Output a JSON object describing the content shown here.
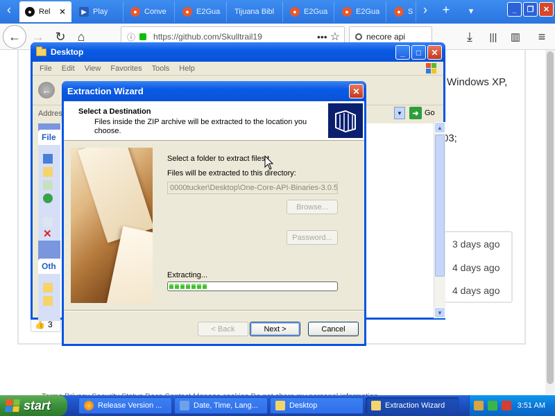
{
  "browser": {
    "tabs": [
      {
        "label": "Rel",
        "icon": "github-icon",
        "active": true
      },
      {
        "label": "Play",
        "icon": "play-icon",
        "active": false
      },
      {
        "label": "Conve",
        "icon": "duckduckgo-icon",
        "active": false
      },
      {
        "label": "E2Gua",
        "icon": "duckduckgo-icon",
        "active": false
      },
      {
        "label": "Tijuana Bibl",
        "icon": "none",
        "active": false
      },
      {
        "label": "E2Gua",
        "icon": "duckduckgo-icon",
        "active": false
      },
      {
        "label": "E2Gua",
        "icon": "duckduckgo-icon",
        "active": false
      },
      {
        "label": "S",
        "icon": "duckduckgo-icon",
        "active": false
      }
    ],
    "url": "https://github.com/Skulltrail19",
    "search_value": "necore api"
  },
  "page": {
    "text_lines": [
      "Windows XP,",
      "03;"
    ],
    "commit_times": [
      "3 days ago",
      "4 days ago",
      "4 days ago"
    ],
    "reaction_count": "3",
    "footer": "Terms  Privacy  Security  Status  Docs  Contact  Manage cookies  Do not share my personal information"
  },
  "explorer": {
    "title": "Desktop",
    "menu": [
      "File",
      "Edit",
      "View",
      "Favorites",
      "Tools",
      "Help"
    ],
    "address_label": "Addres",
    "go_label": "Go",
    "panel_headers": [
      "File",
      "Oth"
    ]
  },
  "wizard": {
    "title": "Extraction Wizard",
    "heading": "Select a Destination",
    "subheading": "Files inside the ZIP archive will be extracted to the location you choose.",
    "select_folder_label": "Select a folder to extract files t",
    "extract_dir_label": "Files will be extracted to this directory:",
    "path_value": "0000tucker\\Desktop\\One-Core-API-Binaries-3.0.5",
    "browse_label": "Browse...",
    "password_label": "Password...",
    "status_label": "Extracting...",
    "progress": 0.22,
    "back_label": "< Back",
    "next_label": "Next >",
    "cancel_label": "Cancel"
  },
  "taskbar": {
    "start_label": "start",
    "items": [
      {
        "label": "Release Version ...",
        "icon": "firefox-icon",
        "active": false
      },
      {
        "label": "Date, Time, Lang...",
        "icon": "control-panel-icon",
        "active": false
      },
      {
        "label": "Desktop",
        "icon": "folder-icon",
        "active": false
      },
      {
        "label": "Extraction Wizard",
        "icon": "folder-icon",
        "active": true
      }
    ],
    "clock": "3:51 AM"
  }
}
